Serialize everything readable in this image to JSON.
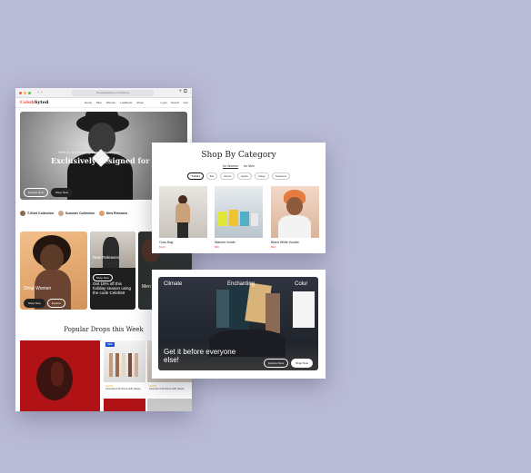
{
  "browser": {
    "url": "thecelebstore.com/shop",
    "logo_main": "Celeb",
    "logo_accent": "Syted",
    "menu": [
      "Home",
      "Men",
      "Women",
      "Lookbook",
      "About"
    ],
    "header_right": [
      "Login",
      "Search",
      "Cart"
    ]
  },
  "hero": {
    "subtitle": "With an outstanding style, only for you",
    "title": "Exclusively designed for you",
    "btn_explore": "Explore Now",
    "btn_shop": "Shop Now"
  },
  "collections": [
    "T-Shirt Collection",
    "Summer Collection",
    "New Releases"
  ],
  "tiles": {
    "women_label": "Shop Women",
    "new_label": "New Releases",
    "promo_button": "Shop Now",
    "promo_text": "Get 15% off this holiday season using the code Celeb50",
    "men_label": "Men",
    "pill_shop": "Shop Now",
    "pill_explore": "Explore"
  },
  "popular": {
    "title": "Popular Drops this Week",
    "badge": "NEW",
    "caption_a": "Lavender knit dress with tassel",
    "caption_b": "Lavender knit dress with tassel"
  },
  "category": {
    "title": "Shop By Category",
    "gender": [
      "for Women",
      "for Men"
    ],
    "filters": [
      "T-Shirt",
      "Bot",
      "Dress",
      "Heels",
      "Cargo",
      "Suspend"
    ],
    "items": [
      {
        "name": "Coco Bag",
        "price": "$120"
      },
      {
        "name": "Warmer Inside",
        "price": "$86"
      },
      {
        "name": "Bland White Hoodie",
        "price": "$64"
      }
    ]
  },
  "banner": {
    "words": [
      "Climate",
      "Enchanting",
      "Colur"
    ],
    "title": "Get it before everyone else!",
    "btn_explore": "Explore Now",
    "btn_shop": "Shop Now"
  }
}
